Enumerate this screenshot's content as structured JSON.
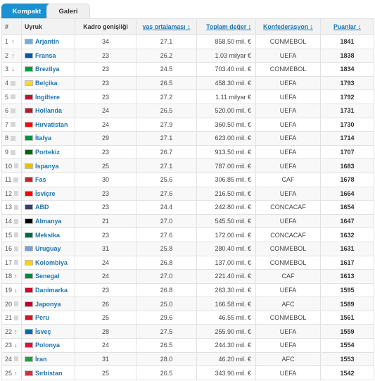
{
  "tabs": [
    {
      "label": "Kompakt",
      "active": true
    },
    {
      "label": "Galeri",
      "active": false
    }
  ],
  "columns": {
    "rank": "#",
    "team": "Uyruk",
    "size": "Kadro genişliği",
    "age": "yaş ortalaması ↕",
    "value": "Toplam değer ↕",
    "conf": "Konfederasyon ↕",
    "points": "Puanlar ↕"
  },
  "rows": [
    {
      "rank": "1",
      "trend": "up",
      "team": "Arjantin",
      "flag": "#74acdf",
      "size": "34",
      "age": "27.1",
      "value": "858.50 mil. €",
      "conf": "CONMEBOL",
      "points": "1841"
    },
    {
      "rank": "2",
      "trend": "up",
      "team": "Fransa",
      "flag": "#0055a4",
      "size": "23",
      "age": "26.2",
      "value": "1.03 milyar €",
      "conf": "UEFA",
      "points": "1838"
    },
    {
      "rank": "3",
      "trend": "down",
      "team": "Brezilya",
      "flag": "#009c3b",
      "size": "23",
      "age": "24.5",
      "value": "703.40 mil. €",
      "conf": "CONMEBOL",
      "points": "1834"
    },
    {
      "rank": "4",
      "trend": "same",
      "team": "Belçika",
      "flag": "#fdda24",
      "size": "23",
      "age": "26.5",
      "value": "458.30 mil. €",
      "conf": "UEFA",
      "points": "1793"
    },
    {
      "rank": "5",
      "trend": "same",
      "team": "İngiltere",
      "flag": "#c8102e",
      "size": "23",
      "age": "27.2",
      "value": "1.11 milyar €",
      "conf": "UEFA",
      "points": "1792"
    },
    {
      "rank": "6",
      "trend": "same",
      "team": "Hollanda",
      "flag": "#ae1c28",
      "size": "24",
      "age": "26.5",
      "value": "520.00 mil. €",
      "conf": "UEFA",
      "points": "1731"
    },
    {
      "rank": "7",
      "trend": "same",
      "team": "Hırvatistan",
      "flag": "#ff0000",
      "size": "24",
      "age": "27.9",
      "value": "360.50 mil. €",
      "conf": "UEFA",
      "points": "1730"
    },
    {
      "rank": "8",
      "trend": "same",
      "team": "İtalya",
      "flag": "#009246",
      "size": "29",
      "age": "27.1",
      "value": "623.00 mil. €",
      "conf": "UEFA",
      "points": "1714"
    },
    {
      "rank": "9",
      "trend": "same",
      "team": "Portekiz",
      "flag": "#006600",
      "size": "23",
      "age": "26.7",
      "value": "913.50 mil. €",
      "conf": "UEFA",
      "points": "1707"
    },
    {
      "rank": "10",
      "trend": "same",
      "team": "İspanya",
      "flag": "#f1bf00",
      "size": "25",
      "age": "27.1",
      "value": "787.00 mil. €",
      "conf": "UEFA",
      "points": "1683"
    },
    {
      "rank": "11",
      "trend": "same",
      "team": "Fas",
      "flag": "#c1272d",
      "size": "30",
      "age": "25.6",
      "value": "306.85 mil. €",
      "conf": "CAF",
      "points": "1678"
    },
    {
      "rank": "12",
      "trend": "same",
      "team": "İsviçre",
      "flag": "#ff0000",
      "size": "23",
      "age": "27.6",
      "value": "216.50 mil. €",
      "conf": "UEFA",
      "points": "1664"
    },
    {
      "rank": "13",
      "trend": "same",
      "team": "ABD",
      "flag": "#3c3b6e",
      "size": "23",
      "age": "24.4",
      "value": "242.80 mil. €",
      "conf": "CONCACAF",
      "points": "1654"
    },
    {
      "rank": "14",
      "trend": "same",
      "team": "Almanya",
      "flag": "#000000",
      "size": "21",
      "age": "27.0",
      "value": "545.50 mil. €",
      "conf": "UEFA",
      "points": "1647"
    },
    {
      "rank": "15",
      "trend": "same",
      "team": "Meksika",
      "flag": "#006847",
      "size": "23",
      "age": "27.6",
      "value": "172.00 mil. €",
      "conf": "CONCACAF",
      "points": "1632"
    },
    {
      "rank": "16",
      "trend": "same",
      "team": "Uruguay",
      "flag": "#7b9fd4",
      "size": "31",
      "age": "25.8",
      "value": "280.40 mil. €",
      "conf": "CONMEBOL",
      "points": "1631"
    },
    {
      "rank": "17",
      "trend": "same",
      "team": "Kolombiya",
      "flag": "#fcd116",
      "size": "24",
      "age": "26.8",
      "value": "137.00 mil. €",
      "conf": "CONMEBOL",
      "points": "1617"
    },
    {
      "rank": "18",
      "trend": "up",
      "team": "Senegal",
      "flag": "#00853f",
      "size": "24",
      "age": "27.0",
      "value": "221.40 mil. €",
      "conf": "CAF",
      "points": "1613"
    },
    {
      "rank": "19",
      "trend": "down",
      "team": "Danimarka",
      "flag": "#c60c30",
      "size": "23",
      "age": "26.8",
      "value": "263.30 mil. €",
      "conf": "UEFA",
      "points": "1595"
    },
    {
      "rank": "20",
      "trend": "same",
      "team": "Japonya",
      "flag": "#bc002d",
      "size": "26",
      "age": "25.0",
      "value": "166.58 mil. €",
      "conf": "AFC",
      "points": "1589"
    },
    {
      "rank": "21",
      "trend": "same",
      "team": "Peru",
      "flag": "#d91023",
      "size": "25",
      "age": "29.6",
      "value": "46.55 mil. €",
      "conf": "CONMEBOL",
      "points": "1561"
    },
    {
      "rank": "22",
      "trend": "up",
      "team": "İsveç",
      "flag": "#006aa7",
      "size": "28",
      "age": "27.5",
      "value": "255.90 mil. €",
      "conf": "UEFA",
      "points": "1559"
    },
    {
      "rank": "23",
      "trend": "down",
      "team": "Polonya",
      "flag": "#dc143c",
      "size": "24",
      "age": "26.5",
      "value": "244.30 mil. €",
      "conf": "UEFA",
      "points": "1554"
    },
    {
      "rank": "24",
      "trend": "same",
      "team": "İran",
      "flag": "#239f40",
      "size": "31",
      "age": "28.0",
      "value": "46.20 mil. €",
      "conf": "AFC",
      "points": "1553"
    },
    {
      "rank": "25",
      "trend": "up",
      "team": "Sırbistan",
      "flag": "#c6363c",
      "size": "25",
      "age": "26.5",
      "value": "343.90 mil. €",
      "conf": "UEFA",
      "points": "1542"
    }
  ],
  "trend_icons": {
    "up": "↑",
    "down": "↓",
    "same": ""
  }
}
